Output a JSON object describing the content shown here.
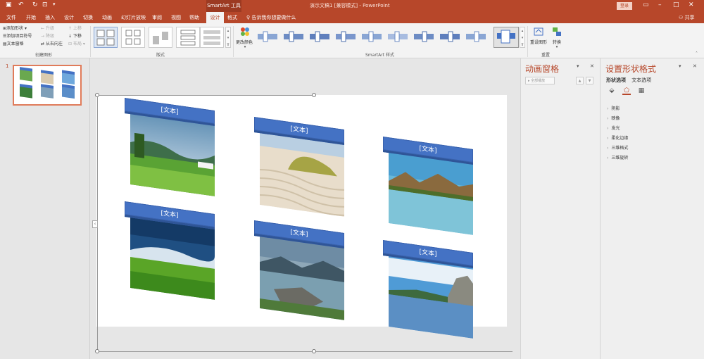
{
  "titlebar": {
    "context_label": "SmartArt 工具",
    "title": "演示文稿1 [兼容模式] - PowerPoint",
    "login": "登录"
  },
  "tabs": [
    "文件",
    "开始",
    "插入",
    "设计",
    "切换",
    "动画",
    "幻灯片放映",
    "审阅",
    "视图",
    "帮助",
    "设计",
    "格式"
  ],
  "active_tab_index": 10,
  "tell_me": "告诉我你想要做什么",
  "share": "共享",
  "ribbon": {
    "create_graphic": {
      "add_shape": "添加形状",
      "add_bullet": "添加项目符号",
      "text_pane": "文本窗格",
      "promote": "升级",
      "demote": "降级",
      "right_to_left": "从右向左",
      "move_up": "上移",
      "move_down": "下移",
      "layout": "布局",
      "group_label": "创建图形"
    },
    "layouts_label": "版式",
    "change_colors": "更改颜色",
    "smartart_styles_label": "SmartArt 样式",
    "reset_graphic": "重设图形",
    "convert": "转换",
    "reset_label": "重置"
  },
  "thumbnails": {
    "slide_number": "1"
  },
  "slide": {
    "card_text": "[文本]",
    "cards": [
      {
        "text": "[文本]",
        "scene": "meadow"
      },
      {
        "text": "[文本]",
        "scene": "dunes"
      },
      {
        "text": "[文本]",
        "scene": "lake-mountains"
      },
      {
        "text": "[文本]",
        "scene": "green-field"
      },
      {
        "text": "[文本]",
        "scene": "rocky-shore"
      },
      {
        "text": "[文本]",
        "scene": "lake-cliff"
      }
    ]
  },
  "animation_pane": {
    "title": "动画窗格",
    "play_all": "全部播放"
  },
  "format_pane": {
    "title": "设置形状格式",
    "tab_shape": "形状选项",
    "tab_text": "文本选项",
    "sections": [
      "阴影",
      "映像",
      "发光",
      "柔化边缘",
      "三维格式",
      "三维旋转"
    ]
  },
  "colors": {
    "accent": "#b7472a",
    "banner": "#4472c4"
  }
}
